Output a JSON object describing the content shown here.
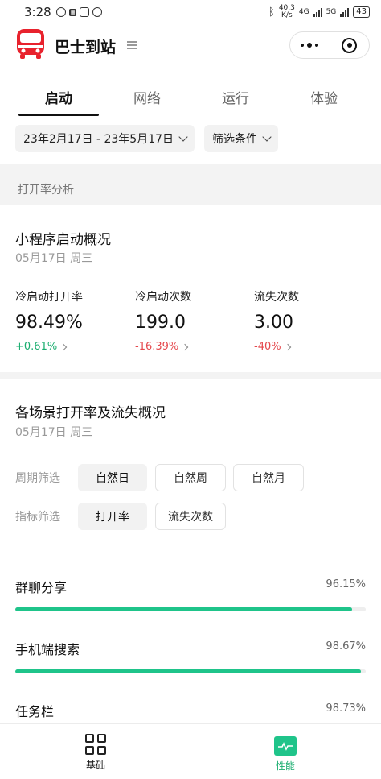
{
  "statusbar": {
    "time": "3:28",
    "netspeed_value": "40.3",
    "netspeed_unit": "K/s",
    "net1": "4G",
    "net2": "5G",
    "battery": "43"
  },
  "header": {
    "title": "巴士到站"
  },
  "tabs": [
    {
      "label": "启动",
      "active": true
    },
    {
      "label": "网络",
      "active": false
    },
    {
      "label": "运行",
      "active": false
    },
    {
      "label": "体验",
      "active": false
    }
  ],
  "filters": {
    "date_range": "23年2月17日 - 23年5月17日",
    "condition": "筛选条件"
  },
  "section_label": "打开率分析",
  "overview": {
    "title": "小程序启动概况",
    "date": "05月17日 周三",
    "metrics": [
      {
        "label": "冷启动打开率",
        "value": "98.49%",
        "delta": "+0.61%",
        "trend": "up"
      },
      {
        "label": "冷启动次数",
        "value": "199.0",
        "delta": "-16.39%",
        "trend": "down"
      },
      {
        "label": "流失次数",
        "value": "3.00",
        "delta": "-40%",
        "trend": "down"
      }
    ]
  },
  "scenes": {
    "title": "各场景打开率及流失概况",
    "date": "05月17日 周三",
    "period_label": "周期筛选",
    "period_options": [
      "自然日",
      "自然周",
      "自然月"
    ],
    "metric_label": "指标筛选",
    "metric_options": [
      "打开率",
      "流失次数"
    ],
    "items": [
      {
        "name": "群聊分享",
        "value": "96.15%",
        "percent": 96.15
      },
      {
        "name": "手机端搜索",
        "value": "98.67%",
        "percent": 98.67
      },
      {
        "name": "任务栏",
        "value": "98.73%",
        "percent": 98.73
      }
    ]
  },
  "bottom_nav": [
    {
      "label": "基础",
      "active": false
    },
    {
      "label": "性能",
      "active": true
    }
  ],
  "colors": {
    "accent": "#1fc48a",
    "up": "#1aad6f",
    "down": "#e5484d",
    "brand_red": "#e8222d"
  }
}
